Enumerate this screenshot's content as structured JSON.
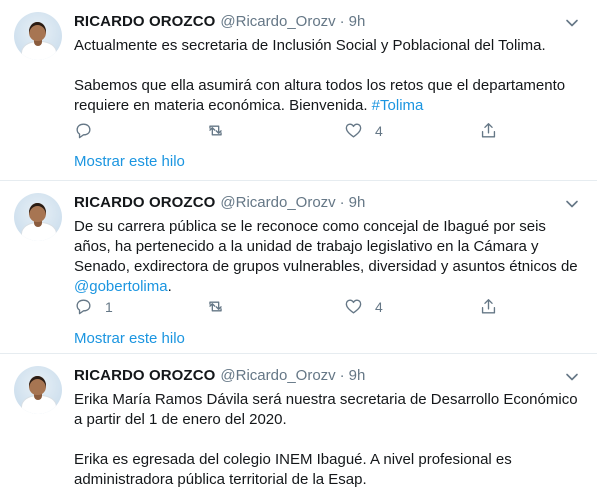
{
  "tweets": [
    {
      "author": {
        "name": "RICARDO OROZCO",
        "handle": "@Ricardo_Orozv"
      },
      "separator": "·",
      "time": "9h",
      "paragraphs": [
        {
          "text": "Actualmente es secretaria de Inclusión Social y Poblacional del Tolima.",
          "link": ""
        },
        {
          "text": "Sabemos que ella asumirá con altura todos los retos que el departamento requiere en materia económica. Bienvenida. ",
          "link": "#Tolima"
        }
      ],
      "actions": {
        "reply_count": "",
        "retweet_count": "",
        "like_count": "4"
      },
      "show_thread": "Mostrar este hilo"
    },
    {
      "author": {
        "name": "RICARDO OROZCO",
        "handle": "@Ricardo_Orozv"
      },
      "separator": "·",
      "time": "9h",
      "paragraphs": [
        {
          "text": "De su carrera pública se le reconoce como concejal de Ibagué por seis años, ha pertenecido a la unidad de trabajo legislativo en la Cámara y Senado, exdirectora de grupos vulnerables, diversidad y asuntos étnicos de ",
          "link": "@gobertolima",
          "after": "."
        }
      ],
      "actions": {
        "reply_count": "1",
        "retweet_count": "",
        "like_count": "4"
      },
      "show_thread": "Mostrar este hilo"
    },
    {
      "author": {
        "name": "RICARDO OROZCO",
        "handle": "@Ricardo_Orozv"
      },
      "separator": "·",
      "time": "9h",
      "paragraphs": [
        {
          "text": "Erika María Ramos Dávila será nuestra secretaria de Desarrollo Económico a partir del 1 de enero del 2020.",
          "link": ""
        },
        {
          "text": "Erika es egresada del colegio INEM Ibagué. A nivel profesional es administradora pública territorial de la Esap.",
          "link": ""
        }
      ]
    }
  ],
  "icons": {
    "reply": "reply-icon",
    "retweet": "retweet-icon",
    "like": "heart-icon",
    "share": "share-icon",
    "more": "chevron-down-icon"
  },
  "colors": {
    "link": "#1b95e0",
    "muted": "#657786",
    "text": "#14171a",
    "divider": "#e6ecf0"
  }
}
